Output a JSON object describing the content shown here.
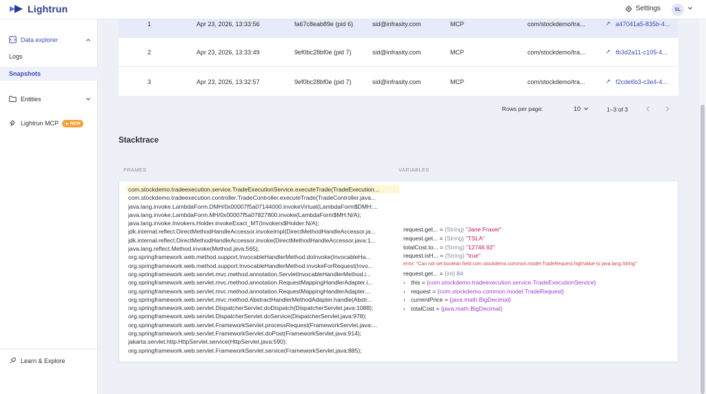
{
  "header": {
    "logo_text": "Lightrun",
    "settings_label": "Settings",
    "avatar_initials": "SL"
  },
  "sidebar": {
    "data_explorer_label": "Data explorer",
    "logs_label": "Logs",
    "snapshots_label": "Snapshots",
    "entities_label": "Entities",
    "mcp_label": "Lightrun MCP",
    "new_badge": "NEW",
    "learn_label": "Learn & Explore"
  },
  "table": {
    "rows": [
      {
        "index": "1",
        "time": "Apr 23, 2026, 13:33:56",
        "agent": "fa67c8eab89e (pid 6)",
        "user": "sid@infrasity.com",
        "source": "MCP",
        "location": "com/stockdemo/tra...",
        "id": "a47041a5-835b-4..."
      },
      {
        "index": "2",
        "time": "Apr 23, 2026, 13:33:49",
        "agent": "9ef0bc28bf0e (pid 7)",
        "user": "sid@infrasity.com",
        "source": "MCP",
        "location": "com/stockdemo/tra...",
        "id": "fb3d2a11-c105-4..."
      },
      {
        "index": "3",
        "time": "Apr 23, 2026, 13:32:57",
        "agent": "9ef0bc28bf0e (pid 7)",
        "user": "sid@infrasity.com",
        "source": "MCP",
        "location": "com/stockdemo/tra...",
        "id": "f2cde6b3-c3e4-4..."
      }
    ]
  },
  "pagination": {
    "rows_per_page_label": "Rows per page:",
    "rows_per_page_value": "10",
    "range": "1–3 of 3"
  },
  "stacktrace": {
    "title": "Stacktrace",
    "frames_header": "FRAMES",
    "variables_header": "VARIABLES",
    "frames": [
      "com.stockdemo.tradeexecution.service.TradeExecutionService.executeTrade(TradeExecution...",
      "com.stockdemo.tradeexecution.controller.TradeController.executeTrade(TradeController.java...",
      "java.lang.invoke.LambdaForm.DMH/0x00007f5a07144000.invokeVirtual(LambdaForm$DMH:...",
      "java.lang.invoke.LambdaForm.MH/0x00007f5a07827800.invoke(LambdaForm$MH:N/A);",
      "java.lang.invoke.Invokers.Holder.invokeExact_MT(Invokers$Holder:N/A);",
      "jdk.internal.reflect.DirectMethodHandleAccessor.invokeImpl(DirectMethodHandleAccessor.ja...",
      "jdk.internal.reflect.DirectMethodHandleAccessor.invoke(DirectMethodHandleAccessor.java:1...",
      "java.lang.reflect.Method.invoke(Method.java:565);",
      "org.springframework.web.method.support.InvocableHandlerMethod.doInvoke(InvocableHa...",
      "org.springframework.web.method.support.InvocableHandlerMethod.invokeForRequest(Invo...",
      "org.springframework.web.servlet.mvc.method.annotation.ServletInvocableHandlerMethod.i...",
      "org.springframework.web.servlet.mvc.method.annotation.RequestMappingHandlerAdapter.i...",
      "org.springframework.web.servlet.mvc.method.annotation.RequestMappingHandlerAdapter....",
      "org.springframework.web.servlet.mvc.method.AbstractHandlerMethodAdapter.handle(Abstr...",
      "org.springframework.web.servlet.DispatcherServlet.doDispatch(DispatcherServlet.java:1088);",
      "org.springframework.web.servlet.DispatcherServlet.doService(DispatcherServlet.java:978);",
      "org.springframework.web.servlet.FrameworkServlet.processRequest(FrameworkServlet.java:...",
      "org.springframework.web.servlet.FrameworkServlet.doPost(FrameworkServlet.java:914);",
      "jakarta.servlet.http.HttpServlet.service(HttpServlet.java:590);",
      "org.springframework.web.servlet.FrameworkServlet.service(FrameworkServlet.java:885);"
    ],
    "variables": [
      {
        "name": "request.get...",
        "type": "{String}",
        "value": "\"Jane Fraser\""
      },
      {
        "name": "request.get...",
        "type": "{String}",
        "value": "\"TSLA\""
      },
      {
        "name": "totalCost.to...",
        "type": "{String}",
        "value": "\"12746.92\""
      },
      {
        "name": "request.isH...",
        "type": "{String}",
        "value": "\"true\""
      }
    ],
    "error_text": "error: \"Can not set boolean field com.stockdemo.common.model.TradeRequest.highValue to java.lang.String\"",
    "int_var": {
      "name": "request.get...",
      "type": "{int}",
      "value": "84"
    },
    "objects": [
      {
        "name": "this",
        "value": "{com.stockdemo.tradeexecution.service.TradeExecutionService}"
      },
      {
        "name": "request",
        "value": "{com.stockdemo.common.model.TradeRequest}"
      },
      {
        "name": "currentPrice",
        "value": "{java.math.BigDecimal}"
      },
      {
        "name": "totalCost",
        "value": "{java.math.BigDecimal}"
      }
    ]
  }
}
